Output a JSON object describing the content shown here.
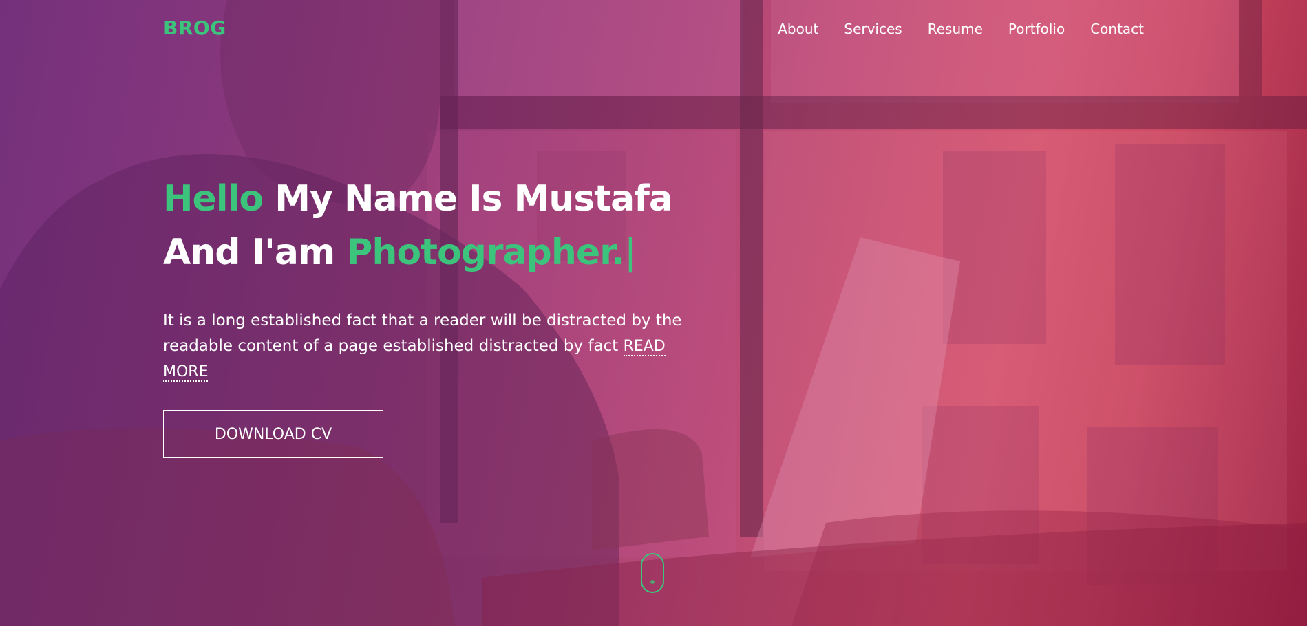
{
  "navbar": {
    "logo": "BROG",
    "items": [
      {
        "label": "About"
      },
      {
        "label": "Services"
      },
      {
        "label": "Resume"
      },
      {
        "label": "Portfolio"
      },
      {
        "label": "Contact"
      }
    ]
  },
  "hero": {
    "line1_highlight": "Hello",
    "line1_rest": "My Name Is Mustafa",
    "line2_prefix": "And I'am",
    "line2_highlight": "Photographer.",
    "cursor": "|",
    "description": "It is a long established fact that a reader will be distracted by the readable content of a page established distracted by fact",
    "read_more": "READ MORE",
    "download_button": "DOWNLOAD CV"
  },
  "colors": {
    "accent": "#3cc47c",
    "text": "#ffffff",
    "gradient_start": "#7d3b82",
    "gradient_end": "#d9556a"
  },
  "icons": {
    "scroll": "mouse-scroll-icon"
  }
}
